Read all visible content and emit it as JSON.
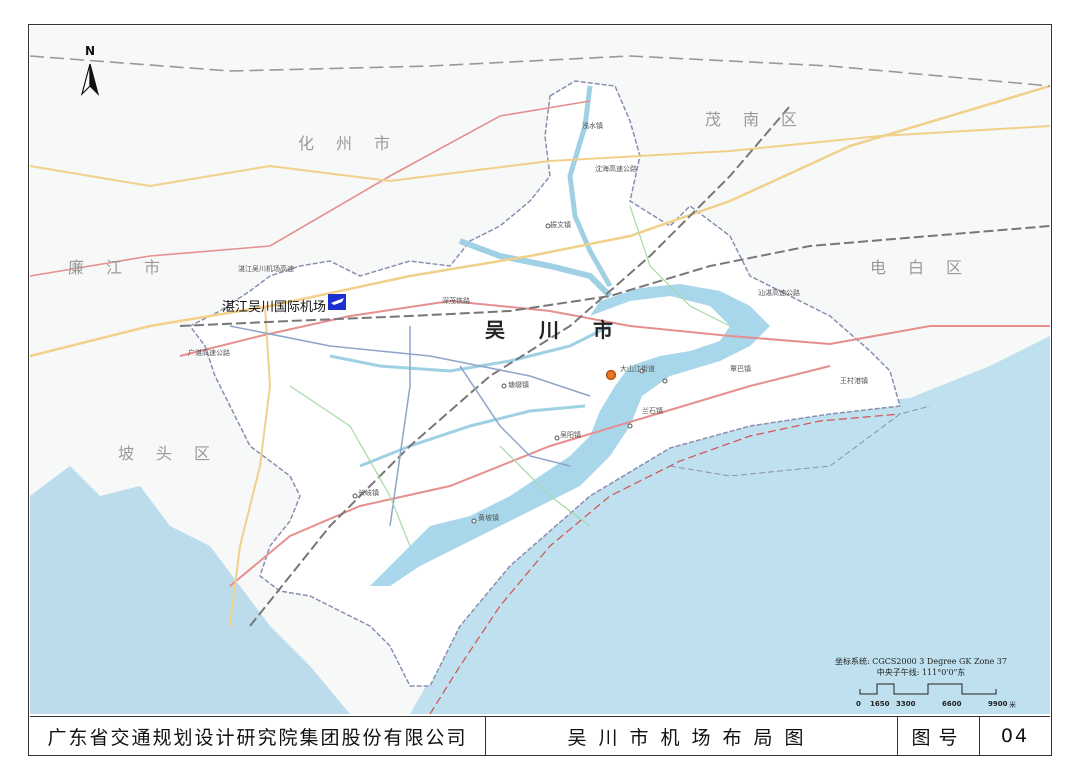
{
  "map": {
    "north_label": "N",
    "regions": [
      {
        "id": "huazhou",
        "text": "化州市"
      },
      {
        "id": "maonan",
        "text": "茂南区"
      },
      {
        "id": "dianbai",
        "text": "电白区"
      },
      {
        "id": "lianjiang",
        "text": "廉江市"
      },
      {
        "id": "potou",
        "text": "坡头区"
      }
    ],
    "city_label": "吴川市",
    "airport_label": "湛江吴川国际机场",
    "place_labels": [
      "长岐镇",
      "塘缀镇",
      "振文镇",
      "吴阳镇",
      "黄坡镇",
      "覃巴镇",
      "王村港镇",
      "兰石镇",
      "浅水镇",
      "大山江街道"
    ],
    "road_labels": [
      "沈海高速公路",
      "湛江吴川机场高速",
      "汕湛高速公路",
      "广湛高速公路",
      "深茂铁路"
    ],
    "coord_system_line1": "坐标系统: CGCS2000 3 Degree GK Zone 37",
    "coord_system_line2": "中央子午线: 111°0'0\"东",
    "scale": {
      "ticks": [
        "0",
        "1650",
        "3300",
        "6600",
        "9900"
      ],
      "unit": "米"
    },
    "colors": {
      "sea": "#bfe0ee",
      "water": "#a8d6ea",
      "land": "#f7f8f8",
      "county": "#ffffff",
      "boundary": "#8a8fb0",
      "rail": "#777777",
      "expressway": "#e58f8f",
      "highway": "#f1d08a",
      "river": "#9fd0e4",
      "airport": "#1c2fd1"
    }
  },
  "titlebar": {
    "organization": "广东省交通规划设计研究院集团股份有限公司",
    "title": "吴川市机场布局图",
    "number_label": "图号",
    "number": "04"
  }
}
